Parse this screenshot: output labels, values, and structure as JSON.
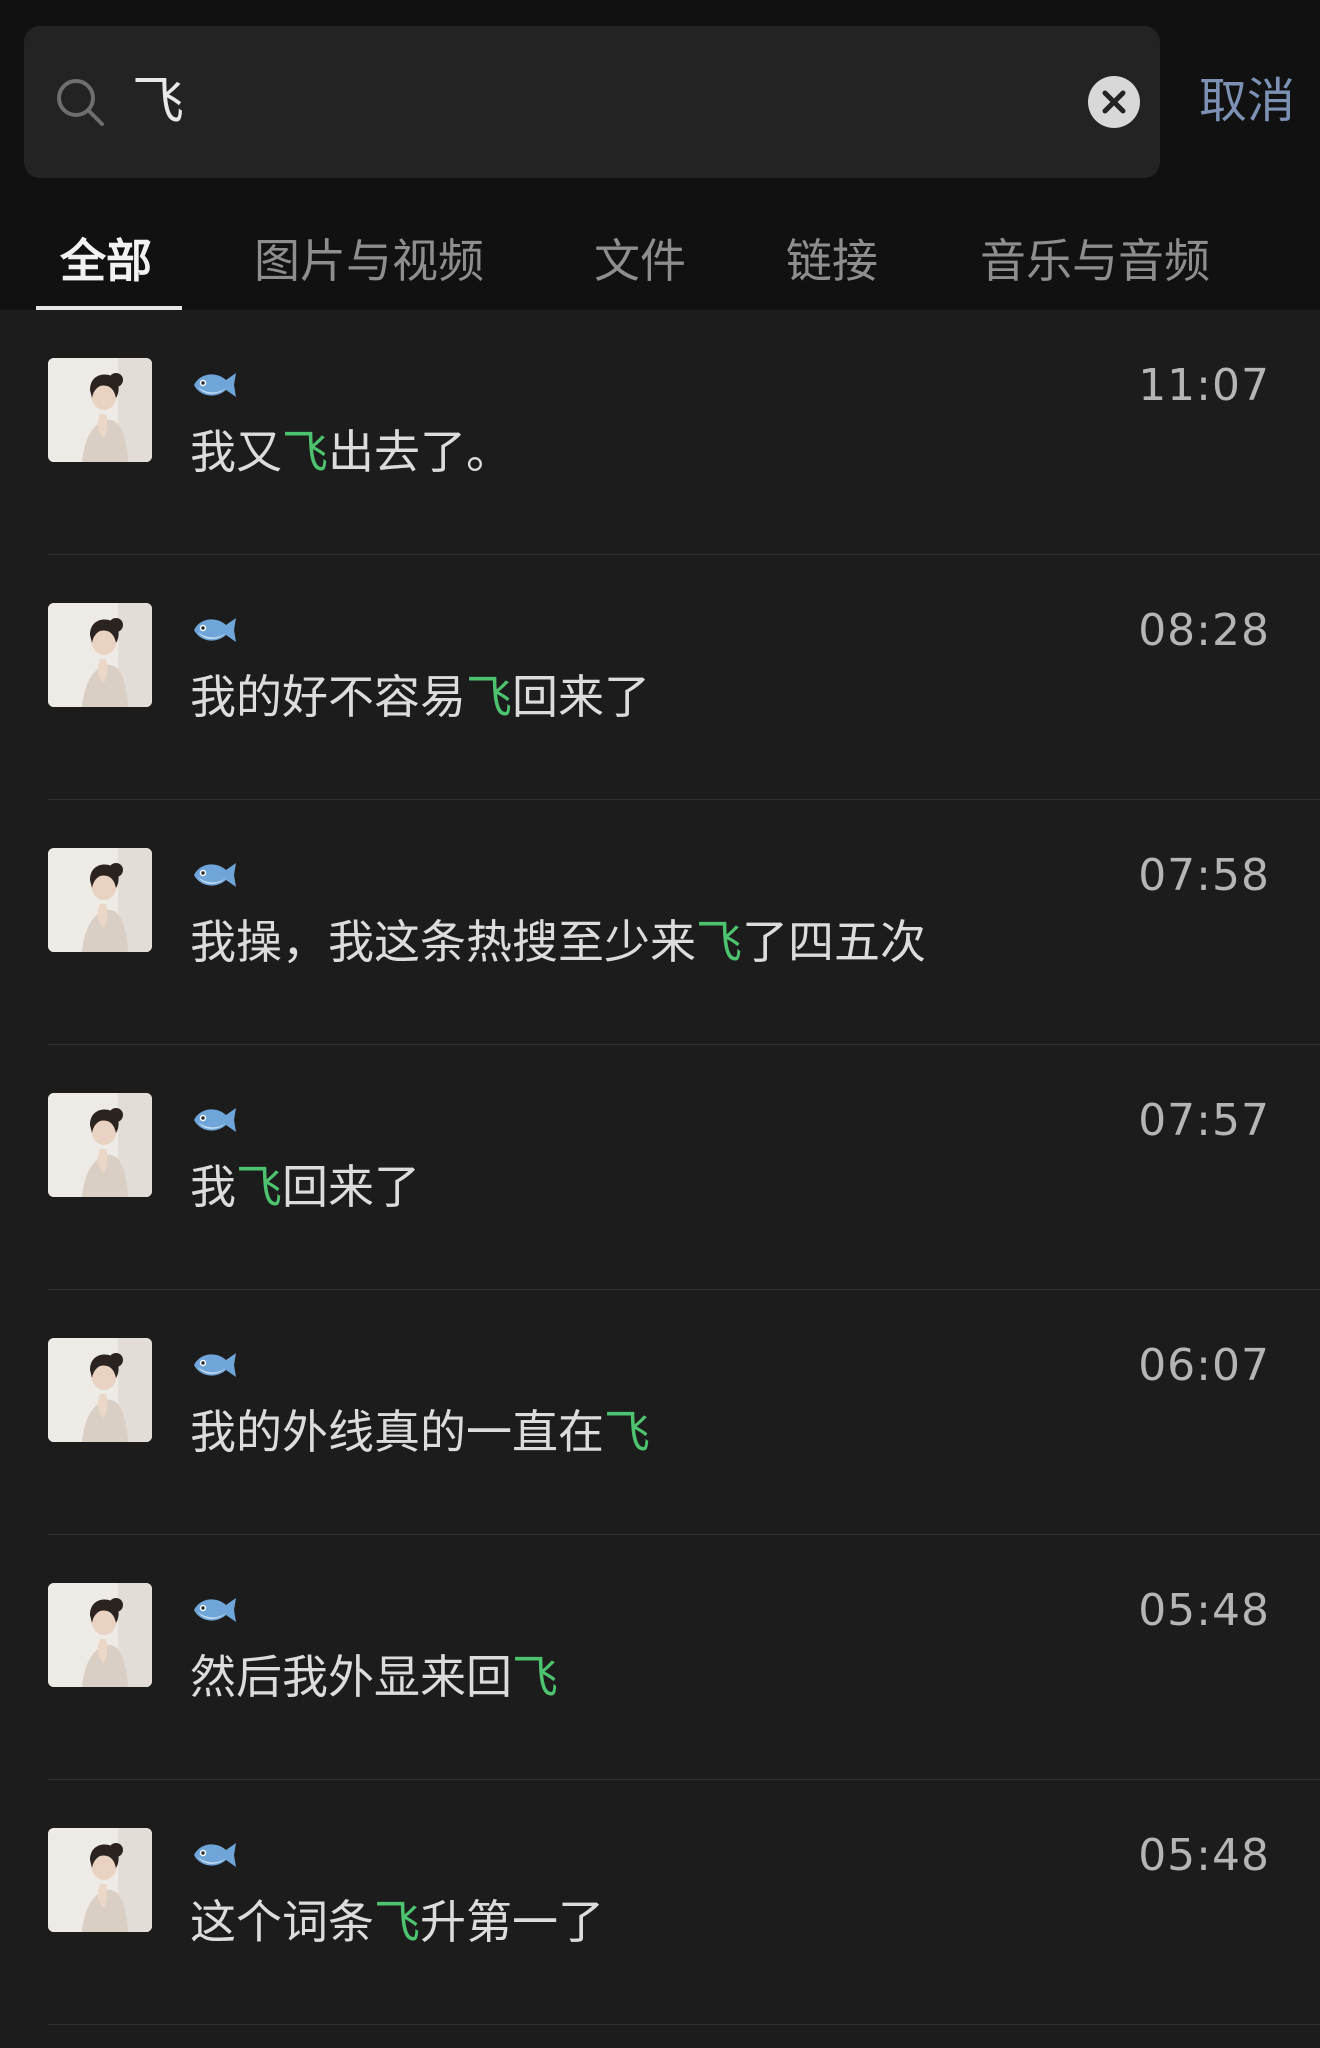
{
  "search": {
    "value": "飞",
    "cancel_label": "取消"
  },
  "tabs": [
    {
      "label": "全部",
      "active": true
    },
    {
      "label": "图片与视频",
      "active": false
    },
    {
      "label": "文件",
      "active": false
    },
    {
      "label": "链接",
      "active": false
    },
    {
      "label": "音乐与音频",
      "active": false
    }
  ],
  "colors": {
    "highlight": "#4ec36f",
    "cancel": "#7d91b4",
    "background": "#1c1c1c"
  },
  "results": [
    {
      "sender_icon": "fish-icon",
      "time": "11:07",
      "before": "我又",
      "match": "飞",
      "after": "出去了。"
    },
    {
      "sender_icon": "fish-icon",
      "time": "08:28",
      "before": "我的好不容易",
      "match": "飞",
      "after": "回来了"
    },
    {
      "sender_icon": "fish-icon",
      "time": "07:58",
      "before": "我操，我这条热搜至少来",
      "match": "飞",
      "after": "了四五次"
    },
    {
      "sender_icon": "fish-icon",
      "time": "07:57",
      "before": "我",
      "match": "飞",
      "after": "回来了"
    },
    {
      "sender_icon": "fish-icon",
      "time": "06:07",
      "before": "我的外线真的一直在",
      "match": "飞",
      "after": ""
    },
    {
      "sender_icon": "fish-icon",
      "time": "05:48",
      "before": "然后我外显来回",
      "match": "飞",
      "after": ""
    },
    {
      "sender_icon": "fish-icon",
      "time": "05:48",
      "before": "这个词条",
      "match": "飞",
      "after": "升第一了"
    }
  ]
}
